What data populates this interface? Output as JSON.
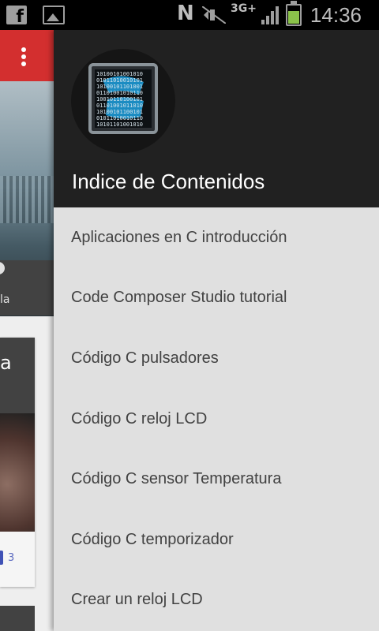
{
  "status_bar": {
    "network": "3G+",
    "n_icon": "N",
    "time": "14:36",
    "battery_color": "#8bc34a",
    "icons": [
      "facebook-icon",
      "image-icon",
      "nfc-icon",
      "mute-icon",
      "network-3g-icon",
      "signal-icon",
      "battery-icon"
    ]
  },
  "background_app": {
    "toolbar_color": "#d32f2f",
    "hero_caption": "la",
    "card_title": "a",
    "card_count": "3"
  },
  "drawer": {
    "title": "Indice de Contenidos",
    "header_color": "#212121",
    "items": [
      {
        "label": "Aplicaciones en C introducción"
      },
      {
        "label": "Code Composer Studio tutorial"
      },
      {
        "label": "Código C pulsadores"
      },
      {
        "label": "Código C reloj LCD"
      },
      {
        "label": "Código C sensor Temperatura"
      },
      {
        "label": "Código C temporizador"
      },
      {
        "label": "Crear un reloj LCD"
      }
    ]
  }
}
